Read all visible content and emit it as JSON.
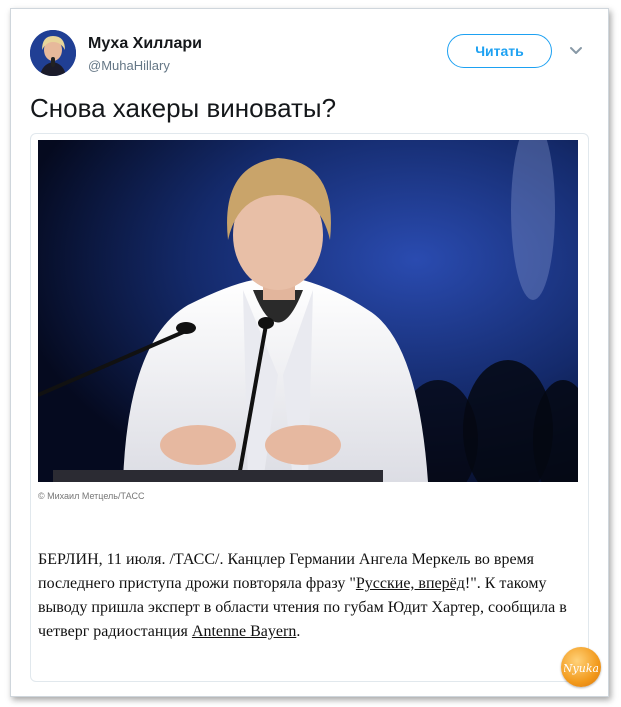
{
  "tweet": {
    "author_name": "Муха Хиллари",
    "author_handle": "@MuhaHillary",
    "follow_label": "Читать",
    "text": "Снова хакеры виноваты?"
  },
  "card": {
    "image_credit": "© Михаил Метцель/ТАСС",
    "article_before": "БЕРЛИН, 11 июля. /ТАСС/. Канцлер Германии Ангела Меркель во время последнего приступа дрожи повторяла фразу \"",
    "article_link_1": "Русские, вперёд",
    "article_middle_1": "!",
    "article_middle_2": "\". К такому выводу пришла эксперт в области чтения по губам Юдит Хартер, сообщила в четверг радиостанция ",
    "article_link_2": "Antenne Bayern",
    "article_after": "."
  },
  "watermark": {
    "text": "Nyuka"
  },
  "colors": {
    "accent": "#1da1f2",
    "name": "#14171a",
    "handle": "#657786"
  },
  "icons": {
    "menu": "chevron-down-icon"
  }
}
